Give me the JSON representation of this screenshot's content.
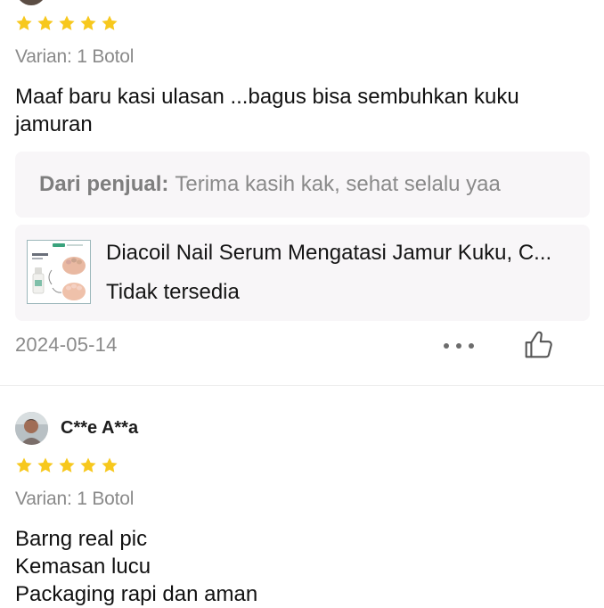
{
  "colors": {
    "star": "#f7c81d",
    "reply_background": "#f8f6f8",
    "muted_text": "#8a8a8a",
    "divider": "#ececec"
  },
  "reviews": [
    {
      "rating": 5,
      "variant": "Varian: 1 Botol",
      "text_lines": [
        "Maaf baru kasi ulasan ...bagus bisa sembuhkan kuku",
        "jamuran"
      ],
      "seller_reply": {
        "label": "Dari penjual:",
        "text": "Terima kasih kak, sehat selalu yaa"
      },
      "product": {
        "title": "Diacoil Nail Serum Mengatasi Jamur Kuku, C...",
        "status": "Tidak tersedia",
        "thumbnail_icon": "nail-serum-product-image"
      },
      "date": "2024-05-14",
      "icons": {
        "more": "more-dots-icon",
        "like": "thumbs-up-icon"
      }
    },
    {
      "username": "C**e A**a",
      "avatar_icon": "user-avatar-image",
      "rating": 5,
      "variant": "Varian: 1 Botol",
      "text_lines": [
        "Barng  real pic",
        "Kemasan lucu",
        "Packaging rapi dan aman"
      ]
    }
  ]
}
